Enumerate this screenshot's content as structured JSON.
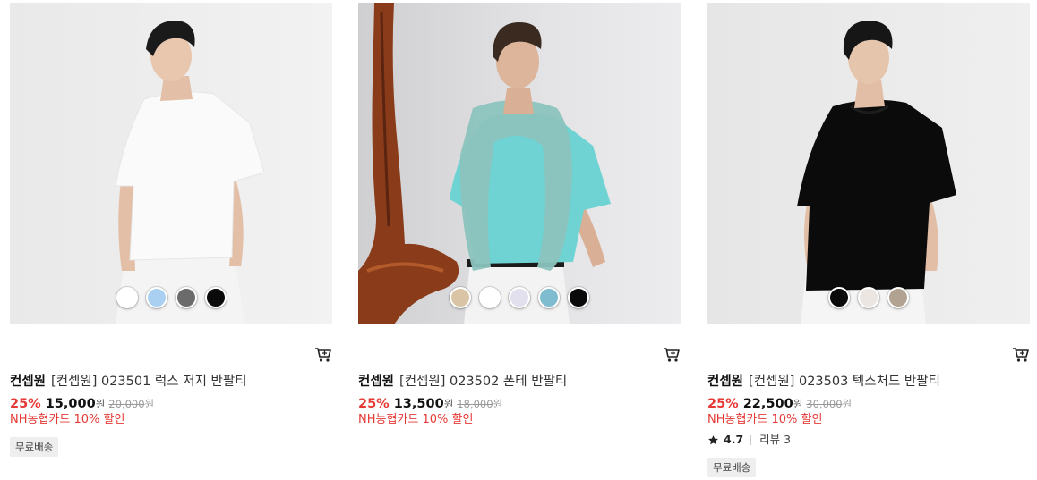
{
  "products": [
    {
      "brand": "컨셉원",
      "name": "[컨셉원] 023501 럭스 저지 반팔티",
      "discount_rate": "25%",
      "price": "15,000",
      "currency": "원",
      "original_price": "20,000",
      "card_benefit": "NH농협카드 10% 할인",
      "badge": "무료배송",
      "image_desc": "model in white t-shirt",
      "swatches": [
        "#ffffff",
        "#a9d0f0",
        "#6b6b6b",
        "#0a0a0a"
      ]
    },
    {
      "brand": "컨셉원",
      "name": "[컨셉원] 023502 폰테 반팔티",
      "discount_rate": "25%",
      "price": "13,500",
      "currency": "원",
      "original_price": "18,000",
      "card_benefit": "NH농협카드 10% 할인",
      "badge": "",
      "image_desc": "model in aqua t-shirt",
      "swatches": [
        "#d9c4a5",
        "#ffffff",
        "#e3e0ee",
        "#7fbcd0",
        "#0a0a0a"
      ]
    },
    {
      "brand": "컨셉원",
      "name": "[컨셉원] 023503 텍스처드 반팔티",
      "discount_rate": "25%",
      "price": "22,500",
      "currency": "원",
      "original_price": "30,000",
      "card_benefit": "NH농협카드 10% 할인",
      "rating": "4.7",
      "review_label": "리뷰",
      "review_count": "3",
      "badge": "무료배송",
      "image_desc": "model in black t-shirt",
      "swatches": [
        "#0a0a0a",
        "#ece6e2",
        "#b2a291"
      ]
    }
  ],
  "icons": {
    "cart": "cart-icon",
    "star": "star-icon"
  },
  "colors": {
    "discount": "#e53935",
    "badge_bg": "#eeeeee"
  }
}
